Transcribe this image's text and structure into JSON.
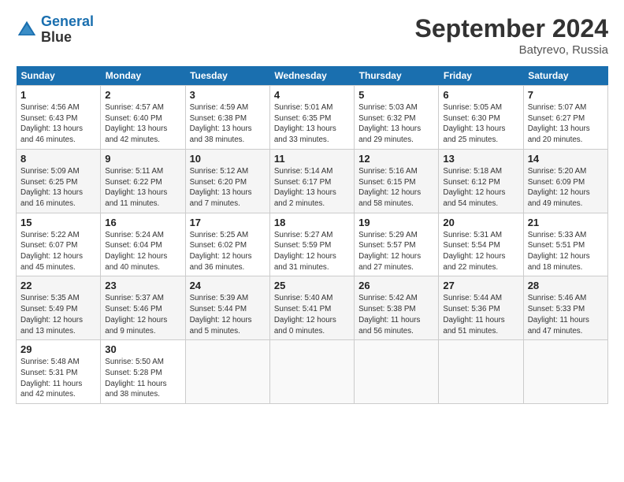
{
  "header": {
    "logo_line1": "General",
    "logo_line2": "Blue",
    "month": "September 2024",
    "location": "Batyrevo, Russia"
  },
  "weekdays": [
    "Sunday",
    "Monday",
    "Tuesday",
    "Wednesday",
    "Thursday",
    "Friday",
    "Saturday"
  ],
  "weeks": [
    [
      {
        "day": "1",
        "info": "Sunrise: 4:56 AM\nSunset: 6:43 PM\nDaylight: 13 hours\nand 46 minutes."
      },
      {
        "day": "2",
        "info": "Sunrise: 4:57 AM\nSunset: 6:40 PM\nDaylight: 13 hours\nand 42 minutes."
      },
      {
        "day": "3",
        "info": "Sunrise: 4:59 AM\nSunset: 6:38 PM\nDaylight: 13 hours\nand 38 minutes."
      },
      {
        "day": "4",
        "info": "Sunrise: 5:01 AM\nSunset: 6:35 PM\nDaylight: 13 hours\nand 33 minutes."
      },
      {
        "day": "5",
        "info": "Sunrise: 5:03 AM\nSunset: 6:32 PM\nDaylight: 13 hours\nand 29 minutes."
      },
      {
        "day": "6",
        "info": "Sunrise: 5:05 AM\nSunset: 6:30 PM\nDaylight: 13 hours\nand 25 minutes."
      },
      {
        "day": "7",
        "info": "Sunrise: 5:07 AM\nSunset: 6:27 PM\nDaylight: 13 hours\nand 20 minutes."
      }
    ],
    [
      {
        "day": "8",
        "info": "Sunrise: 5:09 AM\nSunset: 6:25 PM\nDaylight: 13 hours\nand 16 minutes."
      },
      {
        "day": "9",
        "info": "Sunrise: 5:11 AM\nSunset: 6:22 PM\nDaylight: 13 hours\nand 11 minutes."
      },
      {
        "day": "10",
        "info": "Sunrise: 5:12 AM\nSunset: 6:20 PM\nDaylight: 13 hours\nand 7 minutes."
      },
      {
        "day": "11",
        "info": "Sunrise: 5:14 AM\nSunset: 6:17 PM\nDaylight: 13 hours\nand 2 minutes."
      },
      {
        "day": "12",
        "info": "Sunrise: 5:16 AM\nSunset: 6:15 PM\nDaylight: 12 hours\nand 58 minutes."
      },
      {
        "day": "13",
        "info": "Sunrise: 5:18 AM\nSunset: 6:12 PM\nDaylight: 12 hours\nand 54 minutes."
      },
      {
        "day": "14",
        "info": "Sunrise: 5:20 AM\nSunset: 6:09 PM\nDaylight: 12 hours\nand 49 minutes."
      }
    ],
    [
      {
        "day": "15",
        "info": "Sunrise: 5:22 AM\nSunset: 6:07 PM\nDaylight: 12 hours\nand 45 minutes."
      },
      {
        "day": "16",
        "info": "Sunrise: 5:24 AM\nSunset: 6:04 PM\nDaylight: 12 hours\nand 40 minutes."
      },
      {
        "day": "17",
        "info": "Sunrise: 5:25 AM\nSunset: 6:02 PM\nDaylight: 12 hours\nand 36 minutes."
      },
      {
        "day": "18",
        "info": "Sunrise: 5:27 AM\nSunset: 5:59 PM\nDaylight: 12 hours\nand 31 minutes."
      },
      {
        "day": "19",
        "info": "Sunrise: 5:29 AM\nSunset: 5:57 PM\nDaylight: 12 hours\nand 27 minutes."
      },
      {
        "day": "20",
        "info": "Sunrise: 5:31 AM\nSunset: 5:54 PM\nDaylight: 12 hours\nand 22 minutes."
      },
      {
        "day": "21",
        "info": "Sunrise: 5:33 AM\nSunset: 5:51 PM\nDaylight: 12 hours\nand 18 minutes."
      }
    ],
    [
      {
        "day": "22",
        "info": "Sunrise: 5:35 AM\nSunset: 5:49 PM\nDaylight: 12 hours\nand 13 minutes."
      },
      {
        "day": "23",
        "info": "Sunrise: 5:37 AM\nSunset: 5:46 PM\nDaylight: 12 hours\nand 9 minutes."
      },
      {
        "day": "24",
        "info": "Sunrise: 5:39 AM\nSunset: 5:44 PM\nDaylight: 12 hours\nand 5 minutes."
      },
      {
        "day": "25",
        "info": "Sunrise: 5:40 AM\nSunset: 5:41 PM\nDaylight: 12 hours\nand 0 minutes."
      },
      {
        "day": "26",
        "info": "Sunrise: 5:42 AM\nSunset: 5:38 PM\nDaylight: 11 hours\nand 56 minutes."
      },
      {
        "day": "27",
        "info": "Sunrise: 5:44 AM\nSunset: 5:36 PM\nDaylight: 11 hours\nand 51 minutes."
      },
      {
        "day": "28",
        "info": "Sunrise: 5:46 AM\nSunset: 5:33 PM\nDaylight: 11 hours\nand 47 minutes."
      }
    ],
    [
      {
        "day": "29",
        "info": "Sunrise: 5:48 AM\nSunset: 5:31 PM\nDaylight: 11 hours\nand 42 minutes."
      },
      {
        "day": "30",
        "info": "Sunrise: 5:50 AM\nSunset: 5:28 PM\nDaylight: 11 hours\nand 38 minutes."
      },
      null,
      null,
      null,
      null,
      null
    ]
  ]
}
